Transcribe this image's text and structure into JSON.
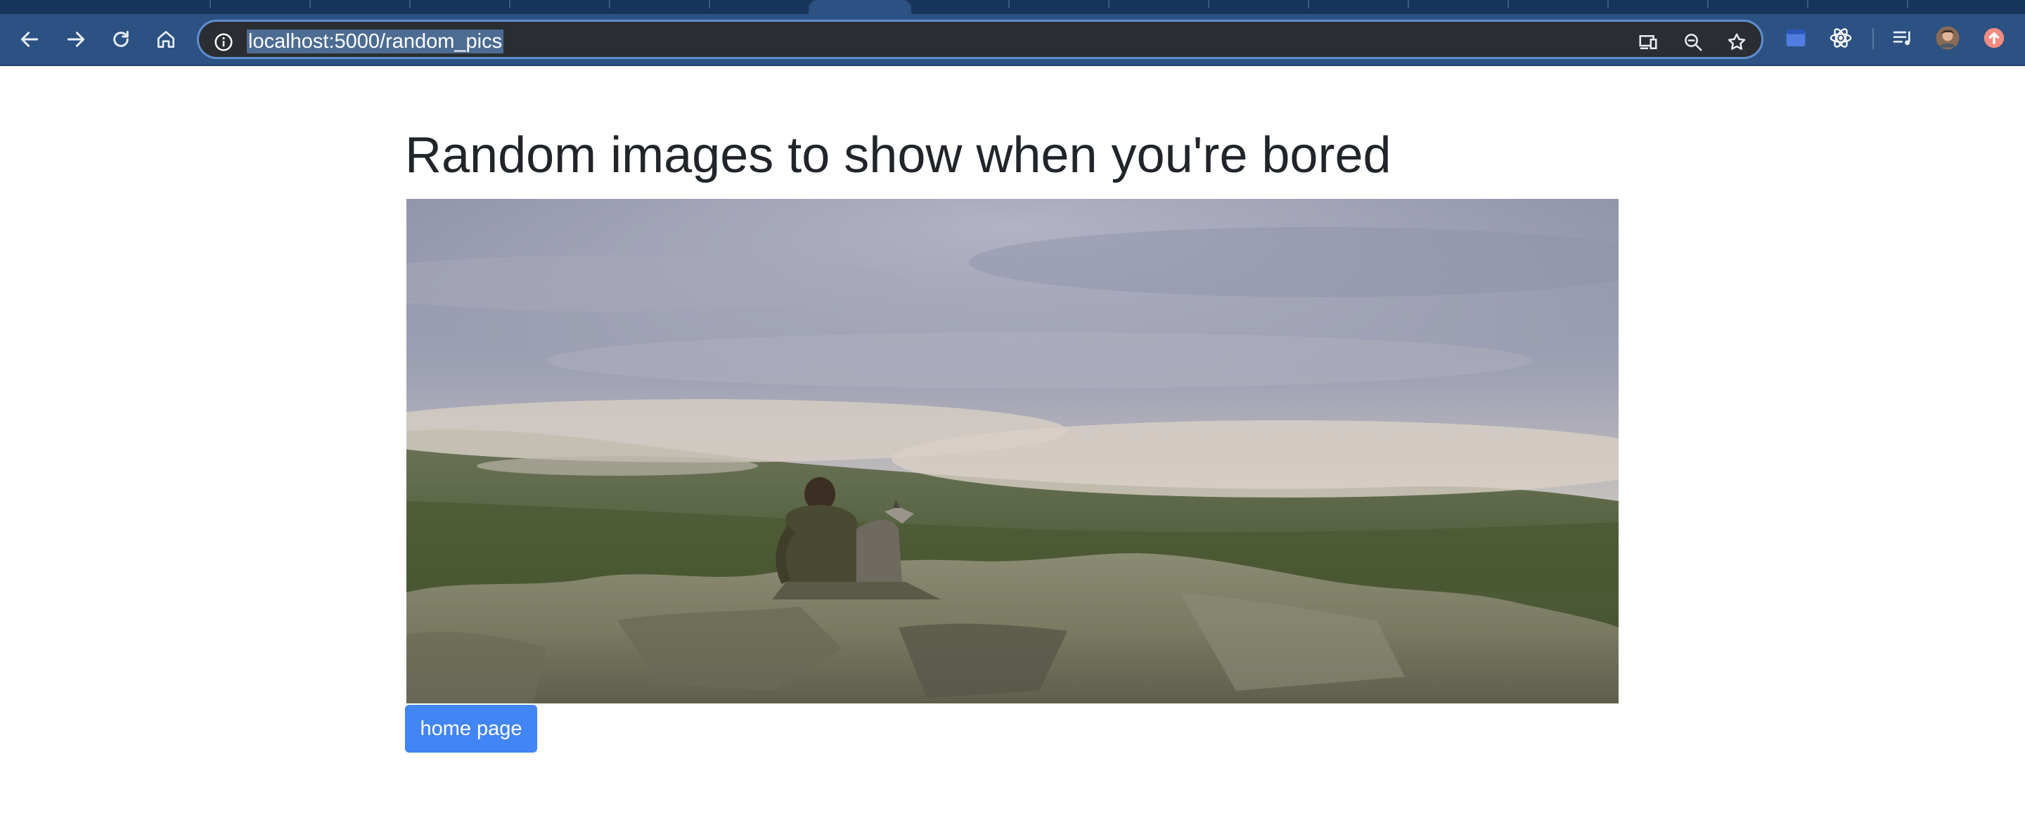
{
  "browser": {
    "url": "localhost:5000/random_pics",
    "nav_icons": [
      "back-arrow-icon",
      "forward-arrow-icon",
      "reload-icon",
      "home-icon"
    ],
    "omnibox_icons": [
      "info-icon",
      "cast-icon",
      "zoom-icon",
      "bookmark-star-icon"
    ],
    "extension_icons": [
      "extension-blue-icon",
      "react-devtools-icon",
      "media-queue-icon",
      "profile-avatar-icon",
      "update-icon"
    ],
    "colors": {
      "toolbar": "#2c5183",
      "tabstrip": "#17345a",
      "url_highlight": "#4d6c93"
    }
  },
  "page": {
    "title": "Random images to show when you're bored",
    "image_alt": "person-with-dog-on-misty-mountain-photo",
    "home_button": "home page",
    "colors": {
      "button": "#4285f4",
      "title": "#212529"
    }
  }
}
